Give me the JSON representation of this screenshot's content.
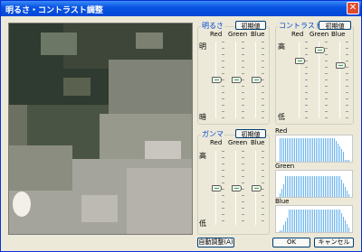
{
  "window": {
    "title": "明るさ・コントラスト調整",
    "close_glyph": "✕"
  },
  "brightness": {
    "title": "明るさ",
    "reset": "初期値",
    "channels": [
      "Red",
      "Green",
      "Blue"
    ],
    "top_label": "明",
    "bottom_label": "暗",
    "values": [
      0.5,
      0.5,
      0.5
    ]
  },
  "contrast": {
    "title": "コントラスト",
    "reset": "初期値",
    "channels": [
      "Red",
      "Green",
      "Blue"
    ],
    "top_label": "高",
    "bottom_label": "低",
    "values": [
      0.23,
      0.08,
      0.3
    ]
  },
  "gamma": {
    "title": "ガンマ",
    "reset": "初期値",
    "channels": [
      "Red",
      "Green",
      "Blue"
    ],
    "top_label": "高",
    "bottom_label": "低",
    "values": [
      0.5,
      0.5,
      0.5
    ]
  },
  "histograms": [
    {
      "name": "Red",
      "color": "#6cb4ee"
    },
    {
      "name": "Green",
      "color": "#6cb4ee"
    },
    {
      "name": "Blue",
      "color": "#6cb4ee"
    }
  ],
  "buttons": {
    "auto": "自動調整(A)",
    "ok": "OK",
    "cancel": "キャンセル"
  }
}
